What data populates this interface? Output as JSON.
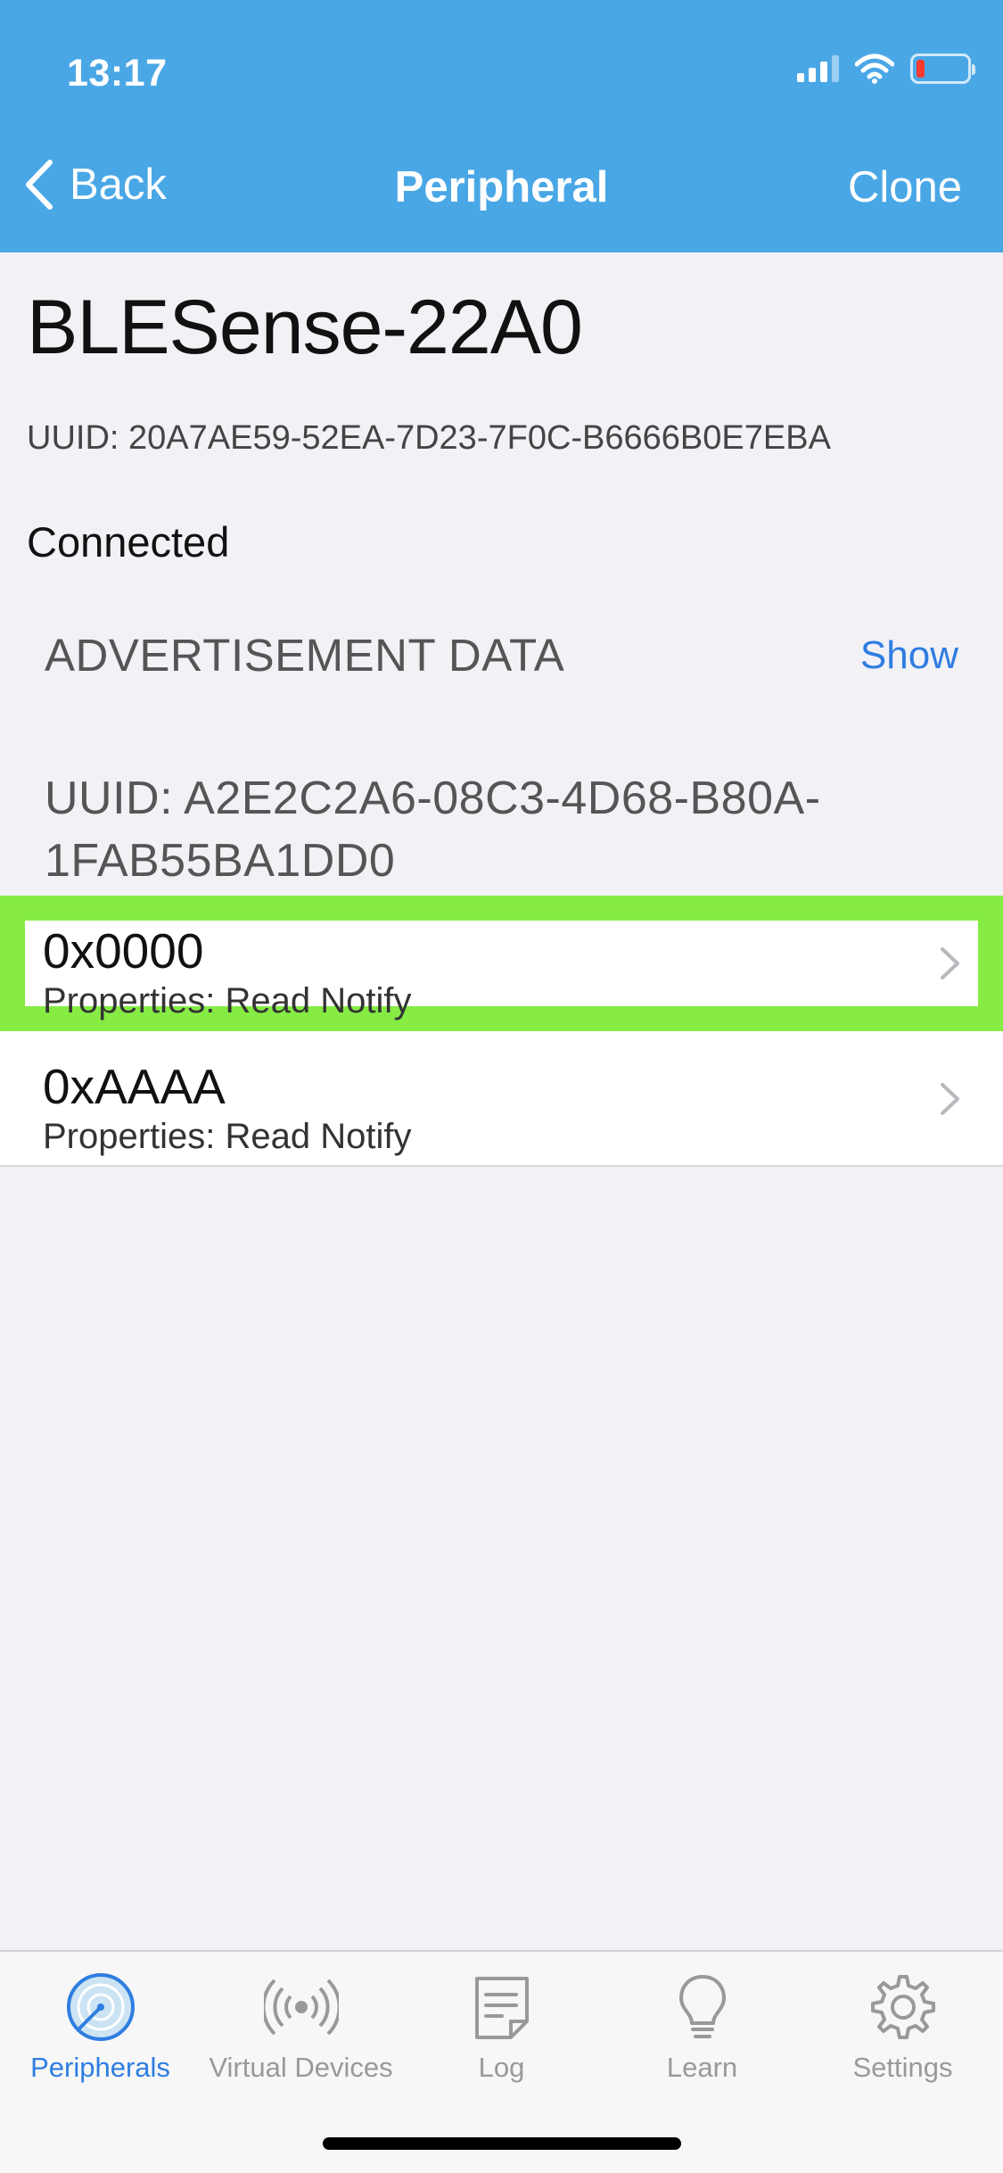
{
  "status_bar": {
    "time": "13:17"
  },
  "nav": {
    "back_label": "Back",
    "title": "Peripheral",
    "clone_label": "Clone"
  },
  "peripheral": {
    "name": "BLESense-22A0",
    "uuid": "UUID: 20A7AE59-52EA-7D23-7F0C-B6666B0E7EBA",
    "status": "Connected"
  },
  "advertisement": {
    "label": "ADVERTISEMENT DATA",
    "show_label": "Show"
  },
  "service": {
    "uuid": "UUID: A2E2C2A6-08C3-4D68-B80A-1FAB55BA1DD0"
  },
  "characteristics": [
    {
      "name": "0x0000",
      "properties": "Properties: Read Notify",
      "highlighted": true
    },
    {
      "name": "0xAAAA",
      "properties": "Properties: Read Notify",
      "highlighted": false
    }
  ],
  "tabs": [
    {
      "label": "Peripherals",
      "icon": "radar-icon",
      "active": true
    },
    {
      "label": "Virtual Devices",
      "icon": "broadcast-icon",
      "active": false
    },
    {
      "label": "Log",
      "icon": "document-icon",
      "active": false
    },
    {
      "label": "Learn",
      "icon": "lightbulb-icon",
      "active": false
    },
    {
      "label": "Settings",
      "icon": "gear-icon",
      "active": false
    }
  ],
  "colors": {
    "header": "#4aa7e6",
    "accent": "#2f7de1",
    "highlight": "#86ec44",
    "background": "#f1f1f6"
  }
}
